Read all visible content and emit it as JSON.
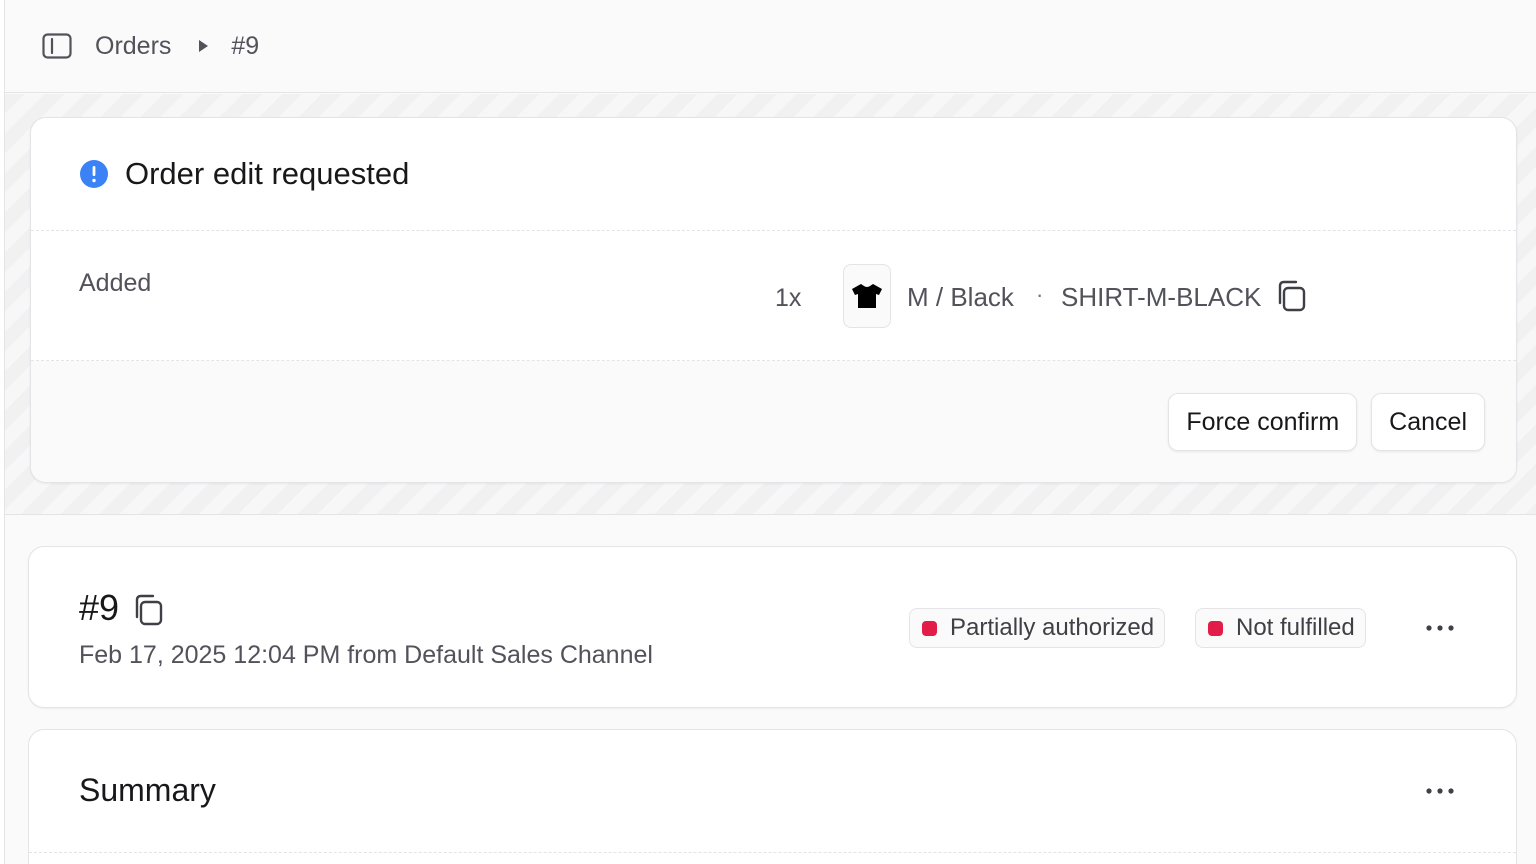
{
  "breadcrumb": {
    "root": "Orders",
    "current": "#9"
  },
  "icons": {
    "sidebar_toggle": "sidebar-toggle-icon",
    "breadcrumb_separator": "triangle-right-icon",
    "info": "exclamation-circle-icon",
    "copy": "copy-icon",
    "more": "ellipsis-horizontal-icon",
    "product": "tshirt-icon"
  },
  "edit_request": {
    "title": "Order edit requested",
    "added_label": "Added",
    "quantity": "1x",
    "variant": "M / Black",
    "separator": "·",
    "sku": "SHIRT-M-BLACK",
    "force_confirm_label": "Force confirm",
    "cancel_label": "Cancel"
  },
  "order": {
    "id": "#9",
    "meta": "Feb 17, 2025 12:04 PM from Default Sales Channel",
    "payment_status": "Partially authorized",
    "fulfillment_status": "Not fulfilled"
  },
  "summary": {
    "title": "Summary"
  },
  "colors": {
    "info": "#3b82f6",
    "status_red": "#e11d48",
    "text_primary": "#18181b",
    "text_secondary": "#52525b",
    "border": "#e4e4e7"
  }
}
